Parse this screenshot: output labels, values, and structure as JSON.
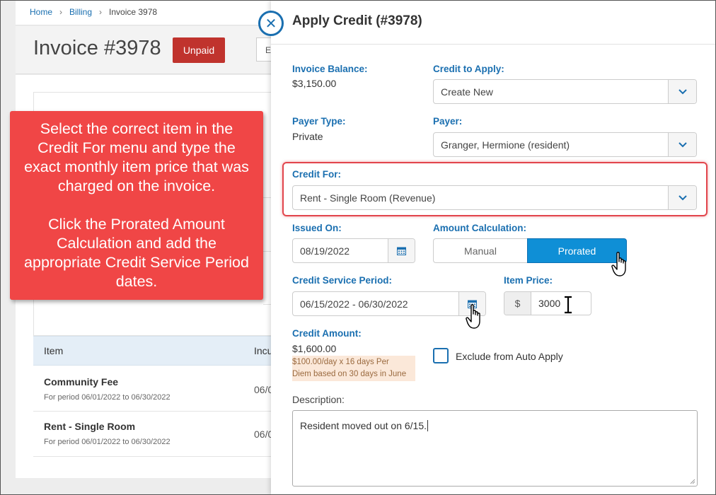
{
  "breadcrumb": {
    "home": "Home",
    "billing": "Billing",
    "current": "Invoice 3978"
  },
  "page": {
    "invoice_title": "Invoice #3978",
    "status_badge": "Unpaid",
    "edge_button": "E"
  },
  "table": {
    "headers": [
      "Item",
      "Incu"
    ],
    "rows": [
      {
        "name": "Community Fee",
        "period": "For period 06/01/2022 to 06/30/2022",
        "cut": "06/0"
      },
      {
        "name": "Rent - Single Room",
        "period": "For period 06/01/2022 to 06/30/2022",
        "cut": "06/0"
      }
    ]
  },
  "callout": {
    "paragraph1": "Select the correct item in the Credit For menu and type the exact monthly item price that was charged on the invoice.",
    "paragraph2": "Click the Prorated Amount Calculation and add the appropriate Credit Service Period dates."
  },
  "modal": {
    "title": "Apply Credit (#3978)",
    "invoice_balance_label": "Invoice Balance:",
    "invoice_balance_value": "$3,150.00",
    "credit_to_apply_label": "Credit to Apply:",
    "credit_to_apply_value": "Create New",
    "payer_type_label": "Payer Type:",
    "payer_type_value": "Private",
    "payer_label": "Payer:",
    "payer_value": "Granger, Hermione (resident)",
    "credit_for_label": "Credit For:",
    "credit_for_value": "Rent - Single Room (Revenue)",
    "issued_on_label": "Issued On:",
    "issued_on_value": "08/19/2022",
    "amount_calc_label": "Amount Calculation:",
    "amount_calc_options": [
      "Manual",
      "Prorated"
    ],
    "amount_calc_selected": "Prorated",
    "service_period_label": "Credit Service Period:",
    "service_period_value": "06/15/2022 - 06/30/2022",
    "item_price_label": "Item Price:",
    "item_price_currency": "$",
    "item_price_value": "3000",
    "credit_amount_label": "Credit Amount:",
    "credit_amount_value": "$1,600.00",
    "credit_amount_note_line1": "$100.00/day x 16 days Per",
    "credit_amount_note_line2": "Diem based on 30 days in June",
    "exclude_label": "Exclude from Auto Apply",
    "exclude_checked": false,
    "description_label": "Description:",
    "description_value": "Resident moved out on 6/15."
  },
  "colors": {
    "accent_blue": "#1a6fb0",
    "prorated_active": "#0f8fd6",
    "callout_red": "#f04646",
    "unpaid_red": "#c0332d",
    "highlight_border": "#e2454c"
  },
  "icons": [
    "close-icon",
    "chevron-down-icon",
    "calendar-icon",
    "hand-pointer-cursor",
    "text-ibeam-cursor"
  ]
}
